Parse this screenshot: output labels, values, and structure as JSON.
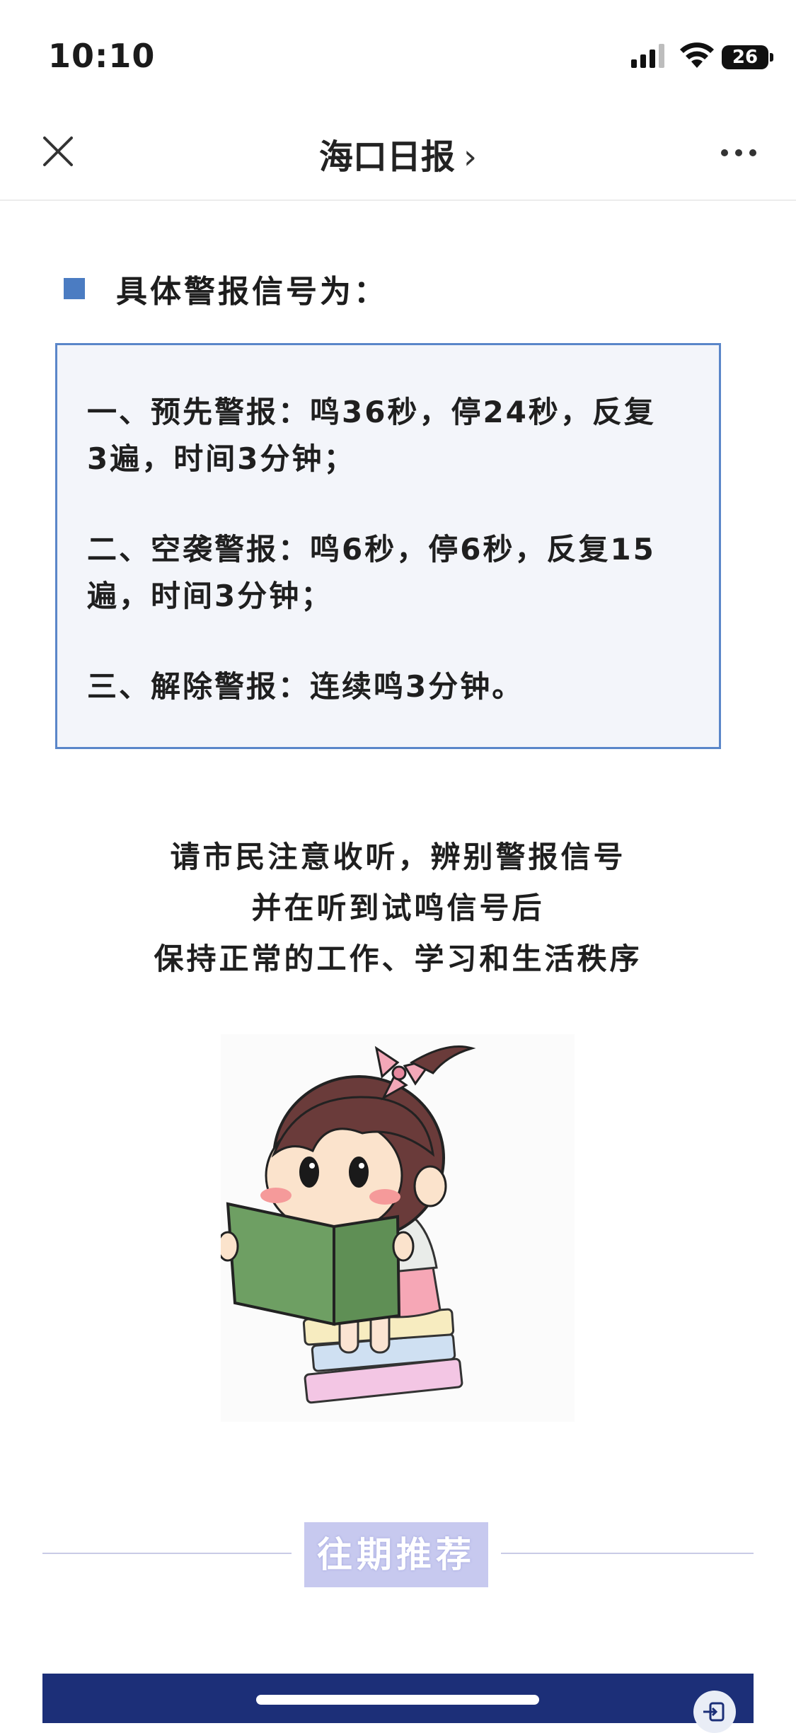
{
  "status_bar": {
    "time": "10:10",
    "battery": "26"
  },
  "nav": {
    "title": "海口日报",
    "chevron": "›"
  },
  "section": {
    "heading": "具体警报信号为："
  },
  "alarms": {
    "line1": "一、预先警报：鸣36秒，停24秒，反复",
    "line2": "3遍，时间3分钟；",
    "line3": "二、空袭警报：鸣6秒，停6秒，反复15",
    "line4": "遍，时间3分钟；",
    "line5": "三、解除警报：连续鸣3分钟。"
  },
  "notice": {
    "line1": "请市民注意收听，辨别警报信号",
    "line2": "并在听到试鸣信号后",
    "line3": "保持正常的工作、学习和生活秩序"
  },
  "past_recommendations": {
    "label": "往期推荐"
  },
  "colors": {
    "accent": "#4b7cc2",
    "box_border": "#5a86c9",
    "box_bg": "#f3f5fa",
    "banner": "#1c2f78"
  },
  "icons": [
    "close-icon",
    "chevron-right-icon",
    "more-icon",
    "signal-icon",
    "wifi-icon",
    "battery-icon"
  ]
}
